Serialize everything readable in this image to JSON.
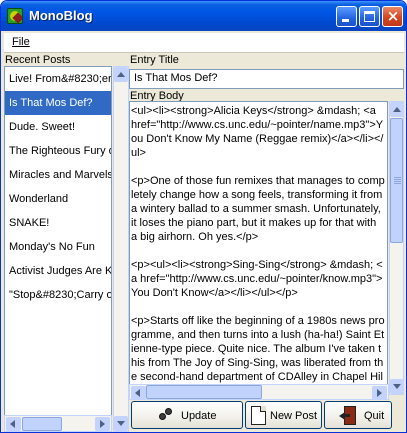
{
  "window": {
    "title": "MonoBlog"
  },
  "menu": {
    "file": "File"
  },
  "labels": {
    "recent_posts": "Recent Posts",
    "entry_title": "Entry Title",
    "entry_body": "Entry Body"
  },
  "posts": [
    {
      "title": "Live! From&#8230;era"
    },
    {
      "title": "Is That Mos Def?"
    },
    {
      "title": "Dude. Sweet!"
    },
    {
      "title": "The Righteous Fury o"
    },
    {
      "title": "Miracles and Marvels"
    },
    {
      "title": "Wonderland"
    },
    {
      "title": "SNAKE!"
    },
    {
      "title": "Monday's No Fun"
    },
    {
      "title": "Activist Judges Are K"
    },
    {
      "title": "\"Stop&#8230;Carry o"
    }
  ],
  "selected_post_index": 1,
  "entry": {
    "title": "Is That Mos Def?",
    "body": "<ul><li><strong>Alicia Keys</strong> &mdash; <a href=\"http://www.cs.unc.edu/~pointer/name.mp3\">You Don't Know My Name (Reggae remix)</a></li></ul>\n\n<p>One of those fun remixes that manages to completely change how a song feels, transforming it from a wintery ballad to a summer smash. Unfortunately, it loses the piano part, but it makes up for that with a big airhorn. Oh yes.</p>\n\n<p><ul><li><strong>Sing-Sing</strong> &mdash; <a href=\"http://www.cs.unc.edu/~pointer/know.mp3\">You Don't Know</a></li></ul></p>\n\n<p>Starts off like the beginning of a 1980s news programme, and then turns into a lush (ha-ha!) Saint Etienne-type piece. Quite nice. The album I've taken this from The Joy of Sing-Sing, was liberated from the second-hand department of CDAlley in Chapel Hill, fo"
  },
  "buttons": {
    "update": "Update",
    "new_post": "New Post",
    "quit": "Quit"
  },
  "icons": {
    "app": "monoblog-app-icon",
    "update": "gears-icon",
    "new_post": "new-document-icon",
    "quit": "exit-door-icon"
  },
  "colors": {
    "titlebar": "#0055e5",
    "selection": "#316ac5",
    "window_bg": "#ece9d8"
  }
}
